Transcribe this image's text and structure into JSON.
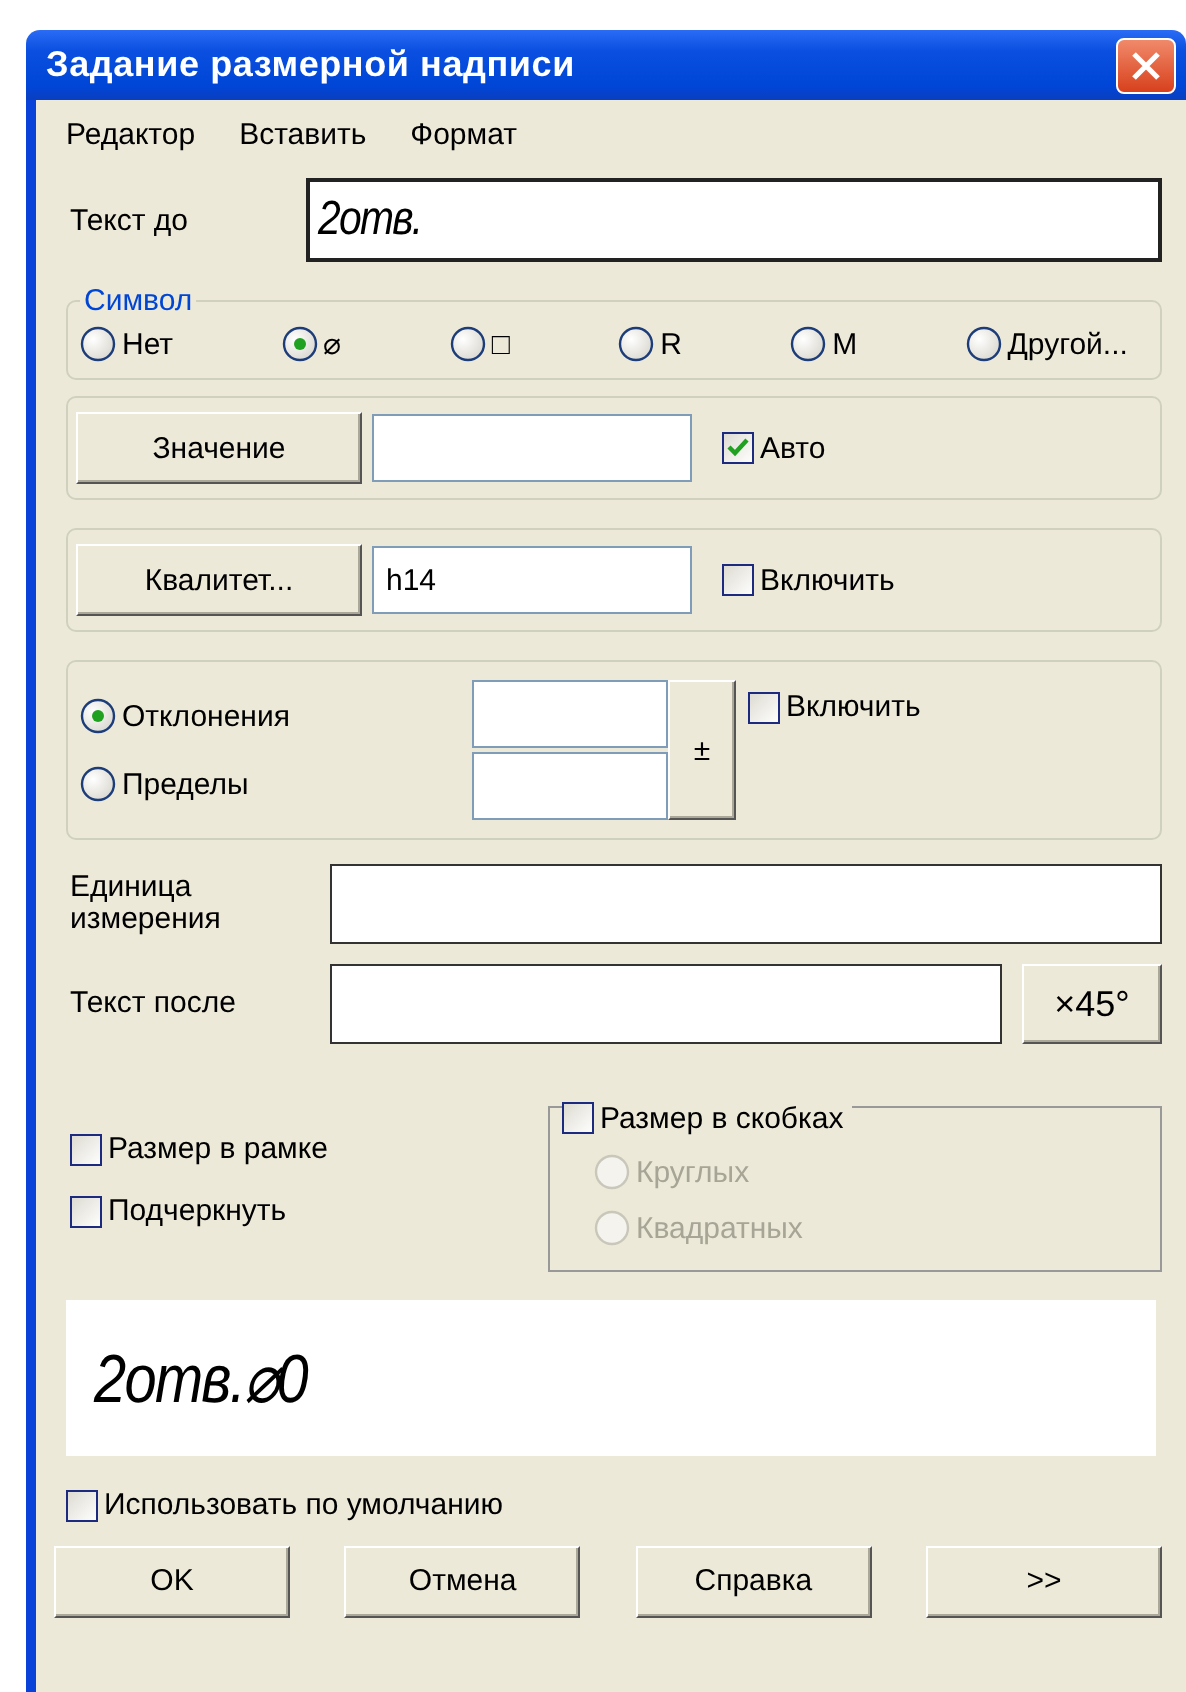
{
  "window": {
    "title": "Задание размерной надписи"
  },
  "menu": [
    "Редактор",
    "Вставить",
    "Формат"
  ],
  "text_before": {
    "label": "Текст до",
    "value": "2отв."
  },
  "symbol": {
    "legend": "Символ",
    "options": [
      {
        "label": "Нет",
        "selected": false
      },
      {
        "label": "⌀",
        "selected": true
      },
      {
        "label": "□",
        "selected": false
      },
      {
        "label": "R",
        "selected": false
      },
      {
        "label": "M",
        "selected": false
      },
      {
        "label": "Другой...",
        "selected": false
      }
    ]
  },
  "value_row": {
    "button": "Значение",
    "checkbox": {
      "label": "Авто",
      "checked": true
    }
  },
  "quality_row": {
    "button": "Квалитет...",
    "value": "h14",
    "checkbox": {
      "label": "Включить",
      "checked": false
    }
  },
  "tolerance": {
    "options": [
      {
        "label": "Отклонения",
        "selected": true
      },
      {
        "label": "Пределы",
        "selected": false
      }
    ],
    "sign_button": "±",
    "checkbox": {
      "label": "Включить",
      "checked": false
    }
  },
  "units": {
    "label": "Единица измерения"
  },
  "text_after": {
    "label": "Текст после",
    "button": "×45°"
  },
  "frame_checkboxes": [
    {
      "label": "Размер в рамке",
      "checked": false
    },
    {
      "label": "Подчеркнуть",
      "checked": false
    }
  ],
  "brackets": {
    "label": "Размер в скобках",
    "checked": false,
    "options": [
      {
        "label": "Круглых",
        "selected": false,
        "disabled": true
      },
      {
        "label": "Квадратных",
        "selected": false,
        "disabled": true
      }
    ]
  },
  "preview": {
    "text": "2отв.⌀0"
  },
  "use_default": {
    "label": "Использовать по умолчанию",
    "checked": false
  },
  "buttons": [
    "OK",
    "Отмена",
    "Справка",
    ">>"
  ]
}
